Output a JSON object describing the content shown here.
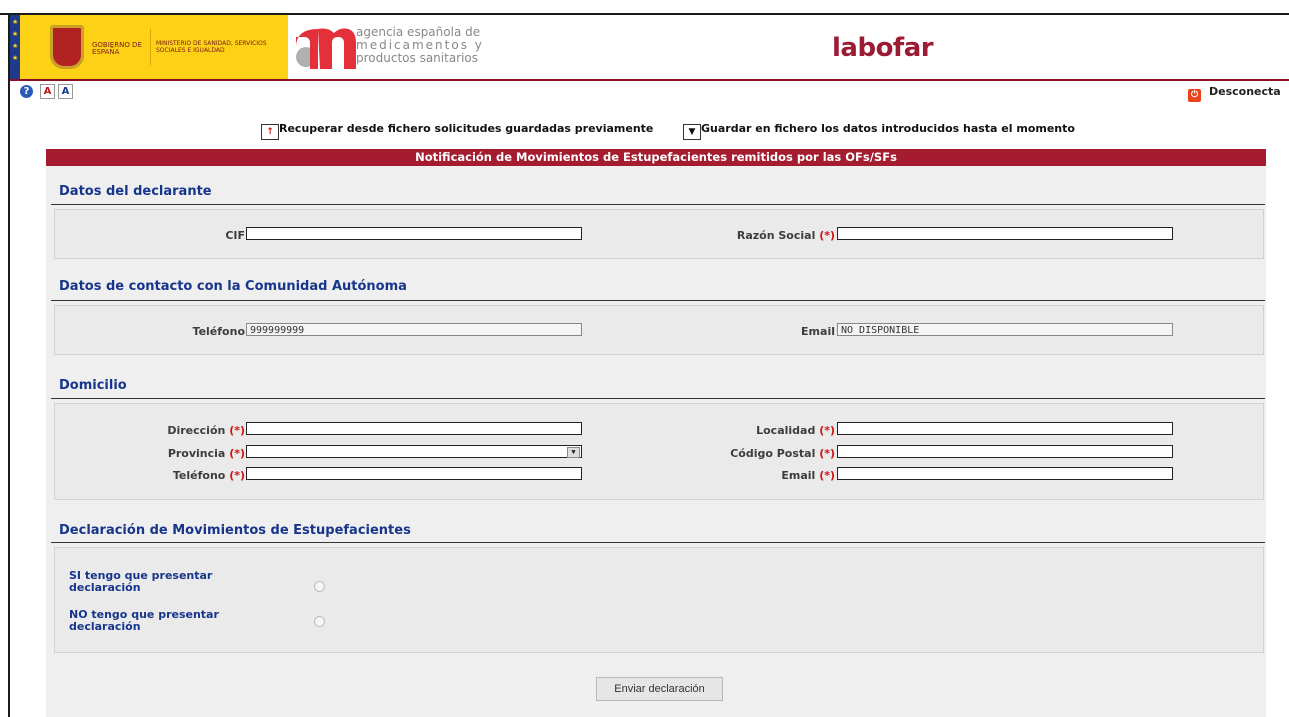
{
  "header": {
    "gov_text": "GOBIERNO DE ESPAÑA",
    "ministry_text": "MINISTERIO DE SANIDAD, SERVICIOS SOCIALES E IGUALDAD",
    "agency_line1": "agencia española de",
    "agency_line2": "medicamentos y",
    "agency_line3": "productos sanitarios",
    "app_name": "labofar"
  },
  "toolbar": {
    "font_small_label": "A",
    "font_large_label": "A",
    "logout_label": "Desconecta"
  },
  "file_actions": {
    "recover_label": "Recuperar desde fichero solicitudes guardadas previamente",
    "save_label": "Guardar en fichero los datos introducidos hasta el momento"
  },
  "form": {
    "title": "Notificación de Movimientos de Estupefacientes remitidos por las OFs/SFs",
    "required_mark": "(*)",
    "declarante": {
      "title": "Datos del declarante",
      "cif_label": "CIF",
      "cif_value": "",
      "razon_label": "Razón Social",
      "razon_value": ""
    },
    "contacto": {
      "title": "Datos de contacto con la Comunidad Autónoma",
      "telefono_label": "Teléfono",
      "telefono_value": "999999999",
      "email_label": "Email",
      "email_value": "NO DISPONIBLE"
    },
    "domicilio": {
      "title": "Domicilio",
      "direccion_label": "Dirección",
      "localidad_label": "Localidad",
      "provincia_label": "Provincia",
      "cp_label": "Código Postal",
      "telefono_label": "Teléfono",
      "email_label": "Email",
      "direccion_value": "",
      "localidad_value": "",
      "provincia_value": "",
      "cp_value": "",
      "telefono_value": "",
      "email_value": ""
    },
    "declaracion": {
      "title": "Declaración de Movimientos de Estupefacientes",
      "si_label_1": "SI tengo que presentar",
      "si_label_2": "declaración",
      "no_label_1": "NO tengo que presentar",
      "no_label_2": "declaración"
    },
    "submit_label": "Enviar declaración"
  },
  "colors": {
    "brand_red": "#a51c30",
    "section_blue": "#17358b",
    "required_red": "#d21313"
  }
}
